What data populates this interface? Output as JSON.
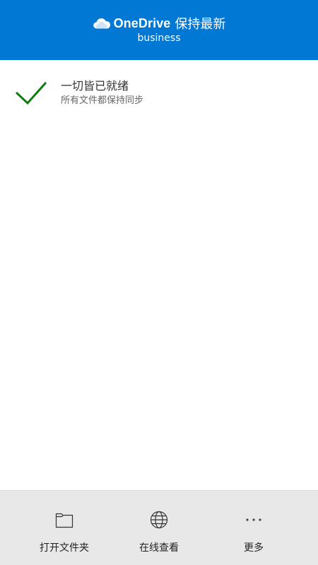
{
  "header": {
    "brand": "OneDrive",
    "title_suffix": "保持最新",
    "subtitle": "business",
    "background_color": "#0078d4",
    "icon": "cloud-icon"
  },
  "status": {
    "title": "一切皆已就绪",
    "subtitle": "所有文件都保持同步",
    "icon": "checkmark-icon",
    "icon_color": "#107c10"
  },
  "footer": {
    "buttons": [
      {
        "label": "打开文件夹",
        "icon": "folder-icon"
      },
      {
        "label": "在线查看",
        "icon": "globe-icon"
      },
      {
        "label": "更多",
        "icon": "more-icon"
      }
    ]
  }
}
